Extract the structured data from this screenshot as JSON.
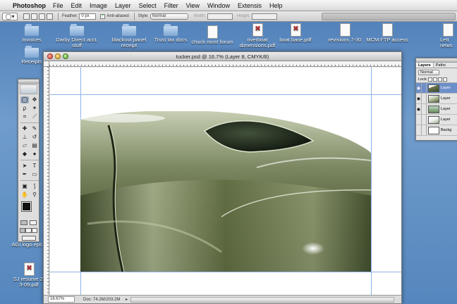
{
  "menubar": {
    "app": "Photoshop",
    "items": [
      "File",
      "Edit",
      "Image",
      "Layer",
      "Select",
      "Filter",
      "View",
      "Window",
      "Extensis",
      "Help"
    ]
  },
  "options": {
    "feather_label": "Feather:",
    "feather_value": "0 px",
    "antialiased_label": "Anti-aliased",
    "style_label": "Style:",
    "style_value": "Normal",
    "width_label": "Width:",
    "height_label": "Height:"
  },
  "desktop_icons": [
    {
      "label": "Invoices",
      "type": "folder"
    },
    {
      "label": "Darby Direct acct. stuff",
      "type": "folder"
    },
    {
      "label": "blackout panel receipt",
      "type": "folder"
    },
    {
      "label": "Trust tax docs",
      "type": "folder"
    },
    {
      "label": "chuck most forum",
      "type": "doc"
    },
    {
      "label": "riverboat dimensions.pdf",
      "type": "pdf"
    },
    {
      "label": "boat base.pdf",
      "type": "pdf"
    },
    {
      "label": "revisions 7-30",
      "type": "doc"
    },
    {
      "label": "MCM FTP access",
      "type": "doc"
    },
    {
      "label": "Lett news",
      "type": "doc"
    },
    {
      "label": "Receipts",
      "type": "folder"
    },
    {
      "label": "AGI logo.eps",
      "type": "eps"
    },
    {
      "label": "SJ resume 2-3-09.pdf",
      "type": "pdf"
    }
  ],
  "document": {
    "title": "tucker.psd @ 16.7% (Layer 8, CMYK/8)",
    "zoom": "16.67%",
    "doc_size": "Doc: 74.2M/203.2M"
  },
  "layers_panel": {
    "tabs": [
      "Layers",
      "Paths"
    ],
    "blend_mode": "Normal",
    "lock_label": "Lock:",
    "layers": [
      {
        "name": "Layer",
        "selected": true
      },
      {
        "name": "Layer",
        "selected": false
      },
      {
        "name": "Layer",
        "selected": false
      },
      {
        "name": "Layer",
        "selected": false
      },
      {
        "name": "Backg",
        "selected": false
      }
    ]
  },
  "colors": {
    "foreground": "#111111",
    "background": "#ffffff",
    "car_body": "#5b6540"
  }
}
